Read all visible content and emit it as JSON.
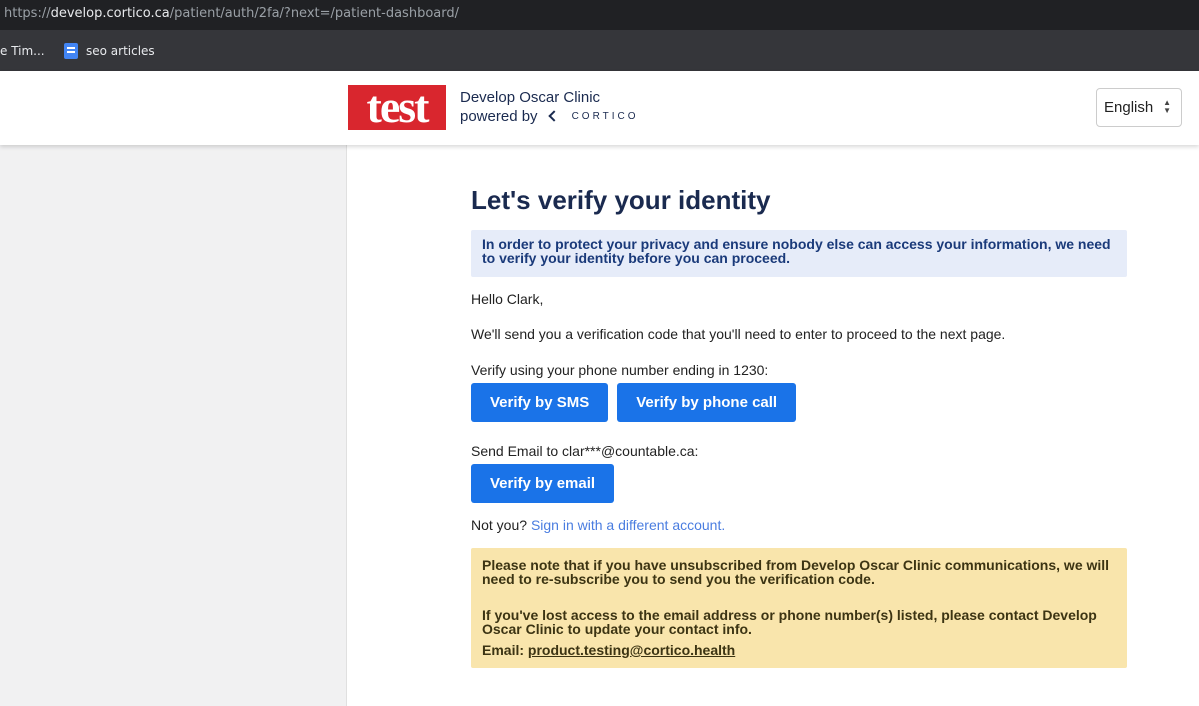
{
  "browser": {
    "url_scheme": "https://",
    "url_host": "develop.cortico.ca",
    "url_path": "/patient/auth/2fa/?next=/patient-dashboard/",
    "bookmarks": [
      {
        "label": "e Tim...",
        "icon": "none"
      },
      {
        "label": "seo articles",
        "icon": "google-doc-icon"
      }
    ]
  },
  "header": {
    "logo_text": "test",
    "clinic_name": "Develop Oscar Clinic",
    "powered_by": "powered by",
    "brand": "CORTICO",
    "language": "English"
  },
  "page": {
    "title": "Let's verify your identity",
    "info": "In order to protect your privacy and ensure nobody else can access your information, we need to verify your identity before you can proceed.",
    "greeting": "Hello Clark,",
    "send_code": "We'll send you a verification code that you'll need to enter to proceed to the next page.",
    "phone_prompt": "Verify using your phone number ending in 1230:",
    "btn_sms": "Verify by SMS",
    "btn_call": "Verify by phone call",
    "email_prompt": "Send Email to clar***@countable.ca:",
    "btn_email": "Verify by email",
    "not_you": "Not you?",
    "sign_in_link": "Sign in with a different account.",
    "warn_1": "Please note that if you have unsubscribed from Develop Oscar Clinic communications, we will need to re-subscribe you to send you the verification code.",
    "warn_2": "If you've lost access to the email address or phone number(s) listed, please contact Develop Oscar Clinic to update your contact info.",
    "warn_email_label": "Email:",
    "warn_email": "product.testing@cortico.health"
  },
  "colors": {
    "primary_button": "#1a73e8",
    "logo_red": "#d9262e",
    "info_bg": "#e6ecf9",
    "warning_bg": "#f9e5ac",
    "link": "#4a7de0"
  }
}
